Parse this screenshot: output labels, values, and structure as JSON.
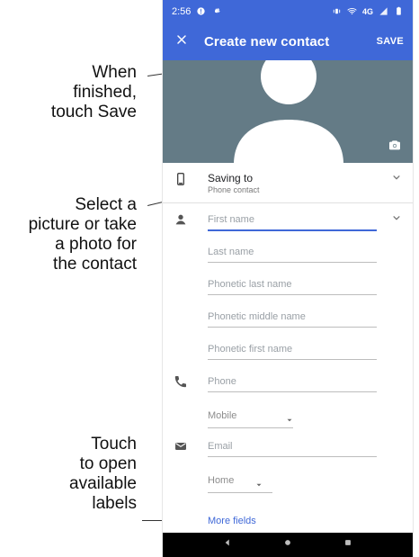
{
  "callouts": {
    "save_hint": "When\nfinished,\ntouch Save",
    "photo_hint": "Select a\npicture or take\na photo for\nthe contact",
    "labels_hint": "Touch\nto open\navailable\nlabels"
  },
  "status_bar": {
    "time": "2:56",
    "network": "4G"
  },
  "app_bar": {
    "title": "Create new contact",
    "save_label": "SAVE"
  },
  "saving_to": {
    "title": "Saving to",
    "subtitle": "Phone contact"
  },
  "name_fields": {
    "first_name_placeholder": "First name",
    "last_name_placeholder": "Last name",
    "phonetic_last_placeholder": "Phonetic last name",
    "phonetic_middle_placeholder": "Phonetic middle name",
    "phonetic_first_placeholder": "Phonetic first name"
  },
  "phone": {
    "placeholder": "Phone",
    "label_value": "Mobile"
  },
  "email": {
    "placeholder": "Email",
    "label_value": "Home"
  },
  "links": {
    "more_fields": "More fields"
  },
  "colors": {
    "primary": "#3f68d8",
    "hero_bg": "#647b86",
    "nav_bg": "#000000"
  },
  "icons": {
    "close": "close-icon",
    "camera": "camera-icon",
    "device": "device-icon",
    "person": "person-icon",
    "phone": "phone-icon",
    "email": "email-icon",
    "chevron": "chevron-down-icon",
    "nav_back": "back-icon",
    "nav_home": "home-icon",
    "nav_recents": "recents-icon"
  }
}
